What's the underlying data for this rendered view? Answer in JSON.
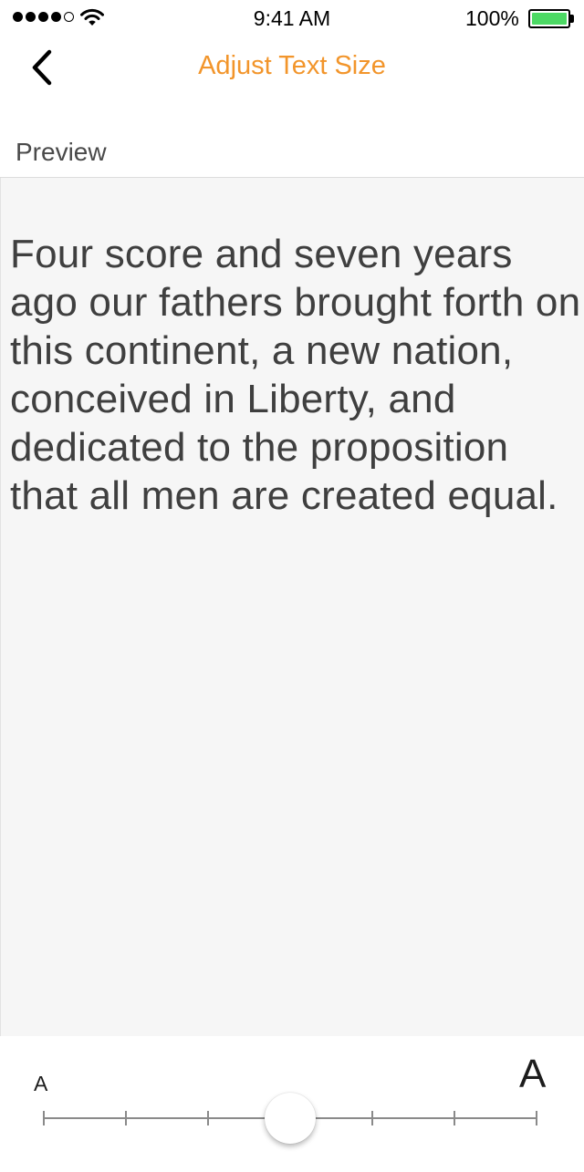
{
  "status_bar": {
    "signal_bars": 4,
    "signal_total": 5,
    "time": "9:41 AM",
    "battery_percent": "100%",
    "battery_level": 1.0,
    "battery_color": "#4cd964",
    "icons": [
      "signal-dots-icon",
      "wifi-icon",
      "battery-icon"
    ]
  },
  "nav": {
    "back_icon": "chevron-left-icon",
    "title": "Adjust Text Size",
    "title_color": "#f2952b"
  },
  "section": {
    "label": "Preview"
  },
  "preview": {
    "text": "Four score and seven years ago our fathers brought forth on this continent, a new nation, conceived in Liberty, and dedicated to the proposition that all men are created equal."
  },
  "slider": {
    "min_label": "A",
    "max_label": "A",
    "steps": 7,
    "selected_index": 3
  }
}
